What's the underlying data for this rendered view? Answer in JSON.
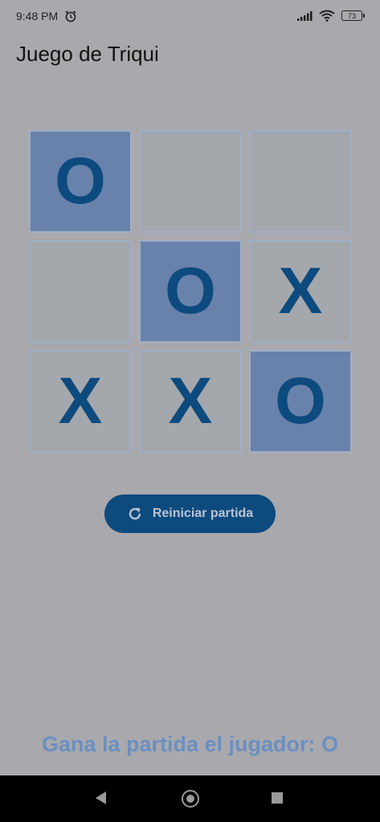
{
  "status_bar": {
    "time": "9:48 PM",
    "battery": "73",
    "icons": [
      "alarm-icon",
      "signal-icon",
      "wifi-icon",
      "battery-icon"
    ]
  },
  "app": {
    "title": "Juego de Triqui"
  },
  "board": {
    "cells": [
      "O",
      "",
      "",
      "",
      "O",
      "X",
      "X",
      "X",
      "O"
    ],
    "winning_cells": [
      0,
      4,
      8
    ]
  },
  "reset": {
    "label": "Reiniciar partida",
    "icon": "refresh-icon"
  },
  "winner": {
    "text": "Gana la partida el jugador: O"
  },
  "nav": {
    "icons": [
      "back-icon",
      "home-icon",
      "recent-apps-icon"
    ]
  },
  "colors": {
    "background": "#a9a9ad",
    "cell": "#a4a8ad",
    "win_cell": "#6882ab",
    "mark": "#0d4a7e",
    "button": "#0d4a7e",
    "winner_text": "#6b8fc0"
  }
}
